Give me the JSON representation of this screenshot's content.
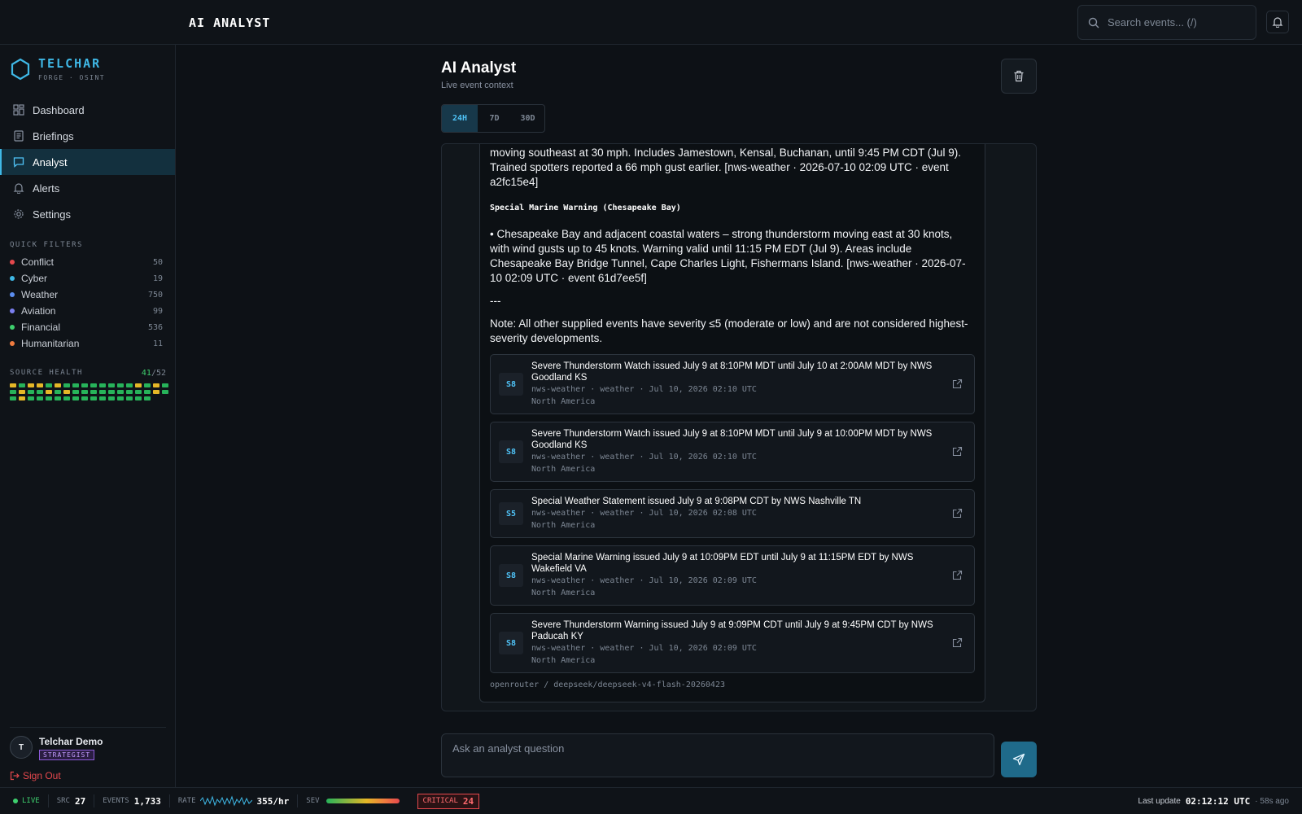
{
  "app": {
    "title": "AI ANALYST"
  },
  "search": {
    "placeholder": "Search events... (/)"
  },
  "brand": {
    "name": "TELCHAR",
    "tagline": "FORGE · OSINT"
  },
  "nav": [
    {
      "label": "Dashboard",
      "icon": "dashboard-icon"
    },
    {
      "label": "Briefings",
      "icon": "briefings-icon"
    },
    {
      "label": "Analyst",
      "icon": "chat-icon",
      "active": true
    },
    {
      "label": "Alerts",
      "icon": "bell-icon"
    },
    {
      "label": "Settings",
      "icon": "gear-icon"
    }
  ],
  "quick_filters": {
    "label": "QUICK FILTERS",
    "items": [
      {
        "label": "Conflict",
        "count": "50",
        "color": "#e5484d"
      },
      {
        "label": "Cyber",
        "count": "19",
        "color": "#3fb8e6"
      },
      {
        "label": "Weather",
        "count": "750",
        "color": "#5b8def"
      },
      {
        "label": "Aviation",
        "count": "99",
        "color": "#7b7ff0"
      },
      {
        "label": "Financial",
        "count": "536",
        "color": "#3ecf6e"
      },
      {
        "label": "Humanitarian",
        "count": "11",
        "color": "#f07b3f"
      }
    ]
  },
  "source_health": {
    "label": "SOURCE HEALTH",
    "ok": "41",
    "total": "/52"
  },
  "user": {
    "name": "Telchar Demo",
    "initial": "T",
    "role": "STRATEGIST",
    "signout": "Sign Out"
  },
  "page": {
    "title": "AI Analyst",
    "subtitle": "Live event context"
  },
  "ranges": [
    {
      "label": "24H",
      "selected": true
    },
    {
      "label": "7D"
    },
    {
      "label": "30D"
    }
  ],
  "message": {
    "p1": "moving southeast at 30 mph. Includes Jamestown, Kensal, Buchanan, until 9:45 PM CDT (Jul 9). Trained spotters reported a 66 mph gust earlier. [nws-weather · 2026-07-10 02:09 UTC · event a2fc15e4]",
    "h2": "Special Marine Warning (Chesapeake Bay)",
    "p2": "• Chesapeake Bay and adjacent coastal waters – strong thunderstorm moving east at 30 knots, with wind gusts up to 45 knots. Warning valid until 11:15 PM EDT (Jul 9). Areas include Chesapeake Bay Bridge Tunnel, Cape Charles Light, Fishermans Island. [nws-weather · 2026-07-10 02:09 UTC · event 61d7ee5f]",
    "sep": "---",
    "p3": "Note: All other supplied events have severity ≤5 (moderate or low) and are not considered highest-severity developments."
  },
  "events": [
    {
      "sev": "S8",
      "title": "Severe Thunderstorm Watch issued July 9 at 8:10PM MDT until July 10 at 2:00AM MDT by NWS Goodland KS",
      "meta": "nws-weather · weather · Jul 10, 2026 02:10 UTC",
      "region": "North America"
    },
    {
      "sev": "S8",
      "title": "Severe Thunderstorm Watch issued July 9 at 8:10PM MDT until July 9 at 10:00PM MDT by NWS Goodland KS",
      "meta": "nws-weather · weather · Jul 10, 2026 02:10 UTC",
      "region": "North America"
    },
    {
      "sev": "S5",
      "title": "Special Weather Statement issued July 9 at 9:08PM CDT by NWS Nashville TN",
      "meta": "nws-weather · weather · Jul 10, 2026 02:08 UTC",
      "region": "North America"
    },
    {
      "sev": "S8",
      "title": "Special Marine Warning issued July 9 at 10:09PM EDT until July 9 at 11:15PM EDT by NWS Wakefield VA",
      "meta": "nws-weather · weather · Jul 10, 2026 02:09 UTC",
      "region": "North America"
    },
    {
      "sev": "S8",
      "title": "Severe Thunderstorm Warning issued July 9 at 9:09PM CDT until July 9 at 9:45PM CDT by NWS Paducah KY",
      "meta": "nws-weather · weather · Jul 10, 2026 02:09 UTC",
      "region": "North America"
    }
  ],
  "model": "openrouter / deepseek/deepseek-v4-flash-20260423",
  "input": {
    "placeholder": "Ask an analyst question"
  },
  "status": {
    "live": "LIVE",
    "src_label": "SRC",
    "src": "27",
    "events_label": "EVENTS",
    "events": "1,733",
    "rate_label": "RATE",
    "rate": "355/hr",
    "sev_label": "SEV",
    "critical_label": "CRITICAL",
    "critical": "24",
    "last_update_label": "Last update",
    "last_update": "02:12:12 UTC",
    "ago": "· 58s ago"
  }
}
